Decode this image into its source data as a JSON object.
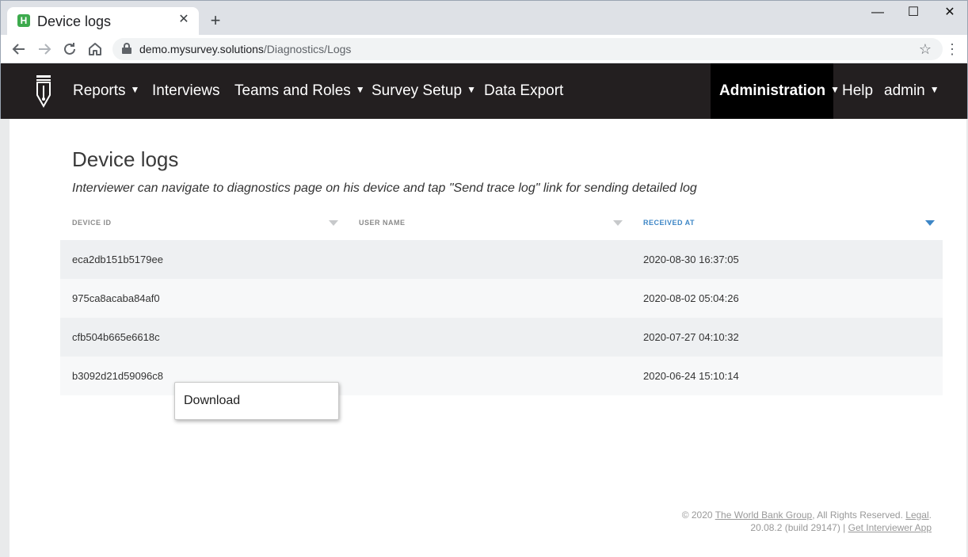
{
  "browser": {
    "tab_title": "Device logs",
    "tab_favicon_letter": "H",
    "tab_close": "✕",
    "new_tab": "+",
    "url_host": "demo.mysurvey.solutions",
    "url_path": "/Diagnostics/Logs",
    "window_controls": {
      "minimize": "—",
      "maximize": "☐",
      "close": "✕"
    }
  },
  "navbar": {
    "items": [
      {
        "label": "Reports",
        "has_caret": true
      },
      {
        "label": "Interviews",
        "has_caret": false
      },
      {
        "label": "Teams and Roles",
        "has_caret": true
      },
      {
        "label": "Survey Setup",
        "has_caret": true
      },
      {
        "label": "Data Export",
        "has_caret": false
      }
    ],
    "admin_label": "Administration",
    "help_label": "Help",
    "user_label": "admin",
    "caret": "▼",
    "active_bg_color": "#000000",
    "bg_color": "#231f20"
  },
  "page": {
    "title": "Device logs",
    "description": "Interviewer can navigate to diagnostics page on his device and tap \"Send trace log\" link for sending detailed log"
  },
  "table": {
    "columns": [
      {
        "label": "DEVICE ID",
        "sorted": false
      },
      {
        "label": "USER NAME",
        "sorted": false
      },
      {
        "label": "RECEIVED AT",
        "sorted": true
      }
    ],
    "rows": [
      {
        "device_id": "eca2db151b5179ee",
        "user_name": "",
        "received_at": "2020-08-30 16:37:05"
      },
      {
        "device_id": "975ca8acaba84af0",
        "user_name": "",
        "received_at": "2020-08-02 05:04:26"
      },
      {
        "device_id": "cfb504b665e6618c",
        "user_name": "",
        "received_at": "2020-07-27 04:10:32"
      },
      {
        "device_id": "b3092d21d59096c8",
        "user_name": "",
        "received_at": "2020-06-24 15:10:14"
      }
    ],
    "sort_color": "#3d86c6"
  },
  "context_menu": {
    "items": [
      {
        "label": "Download"
      }
    ]
  },
  "footer": {
    "copyright_prefix": "© 2020 ",
    "org_link": "The World Bank Group",
    "rights": ", All Rights Reserved. ",
    "legal_link": "Legal",
    "legal_suffix": ".",
    "version": "20.08.2 (build 29147) | ",
    "app_link": "Get Interviewer App"
  }
}
